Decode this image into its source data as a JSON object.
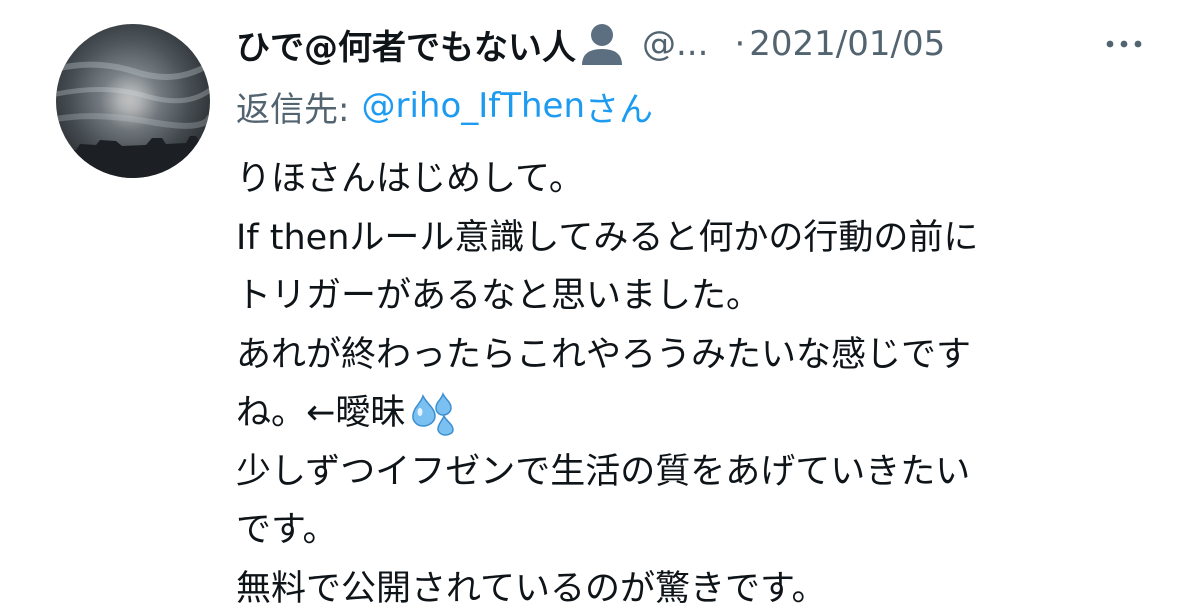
{
  "tweet": {
    "author": {
      "display_name": "ひで@何者でもない人",
      "badge_icon": "person-silhouette-icon",
      "handle": "@...",
      "avatar": "sky-sun-avatar"
    },
    "separator": "·",
    "date": "2021/01/05",
    "more_icon": "more-dots-icon",
    "reply": {
      "prefix": "返信先:",
      "handle": "@riho_IfThen",
      "suffix": "さん"
    },
    "body_lines": [
      "りほさんはじめして。",
      "If thenルール意識してみると何かの行動の前に",
      "トリガーがあるなと思いました。",
      "あれが終わったらこれやろうみたいな感じです",
      "ね。←曖昧",
      "少しずつイフゼンで生活の質をあげていきたい",
      "です。",
      "無料で公開されているのが驚きです。"
    ],
    "emoji_icon": "sweat-droplets-icon",
    "colors": {
      "text": "#0f1419",
      "secondary": "#536471",
      "link": "#1d9bf0"
    }
  }
}
